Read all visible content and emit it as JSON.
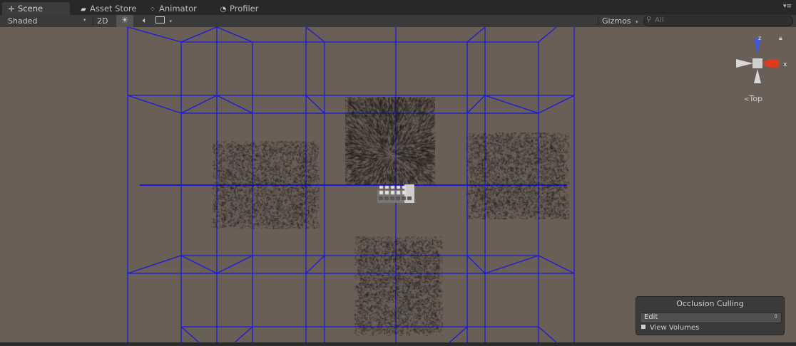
{
  "tabs": [
    {
      "label": "Scene",
      "icon": "scene-crosshair-icon",
      "active": true
    },
    {
      "label": "Asset Store",
      "icon": "asset-store-icon",
      "active": false
    },
    {
      "label": "Animator",
      "icon": "animator-icon",
      "active": false
    },
    {
      "label": "Profiler",
      "icon": "profiler-icon",
      "active": false
    }
  ],
  "toolbar": {
    "draw_mode": "Shaded",
    "mode_2d": "2D",
    "lighting_icon": "sun-icon",
    "audio_icon": "audio-icon",
    "effects_icon": "image-effects-icon",
    "gizmos": "Gizmos",
    "search_placeholder": "All",
    "search_icon": "search-icon"
  },
  "gizmo": {
    "axis_label": "z",
    "view_label": "Top"
  },
  "occlusion_panel": {
    "title": "Occlusion Culling",
    "mode": "Edit",
    "option": "View Volumes"
  },
  "colors": {
    "viewport_bg": "#6a5f57",
    "wire": "#1a1ad8",
    "toolbar": "#3a3a3a",
    "tab_bg": "#282828",
    "gizmo_x": "#e03a1e",
    "gizmo_y": "#e8e8e8",
    "gizmo_z": "#3f5bd8"
  }
}
